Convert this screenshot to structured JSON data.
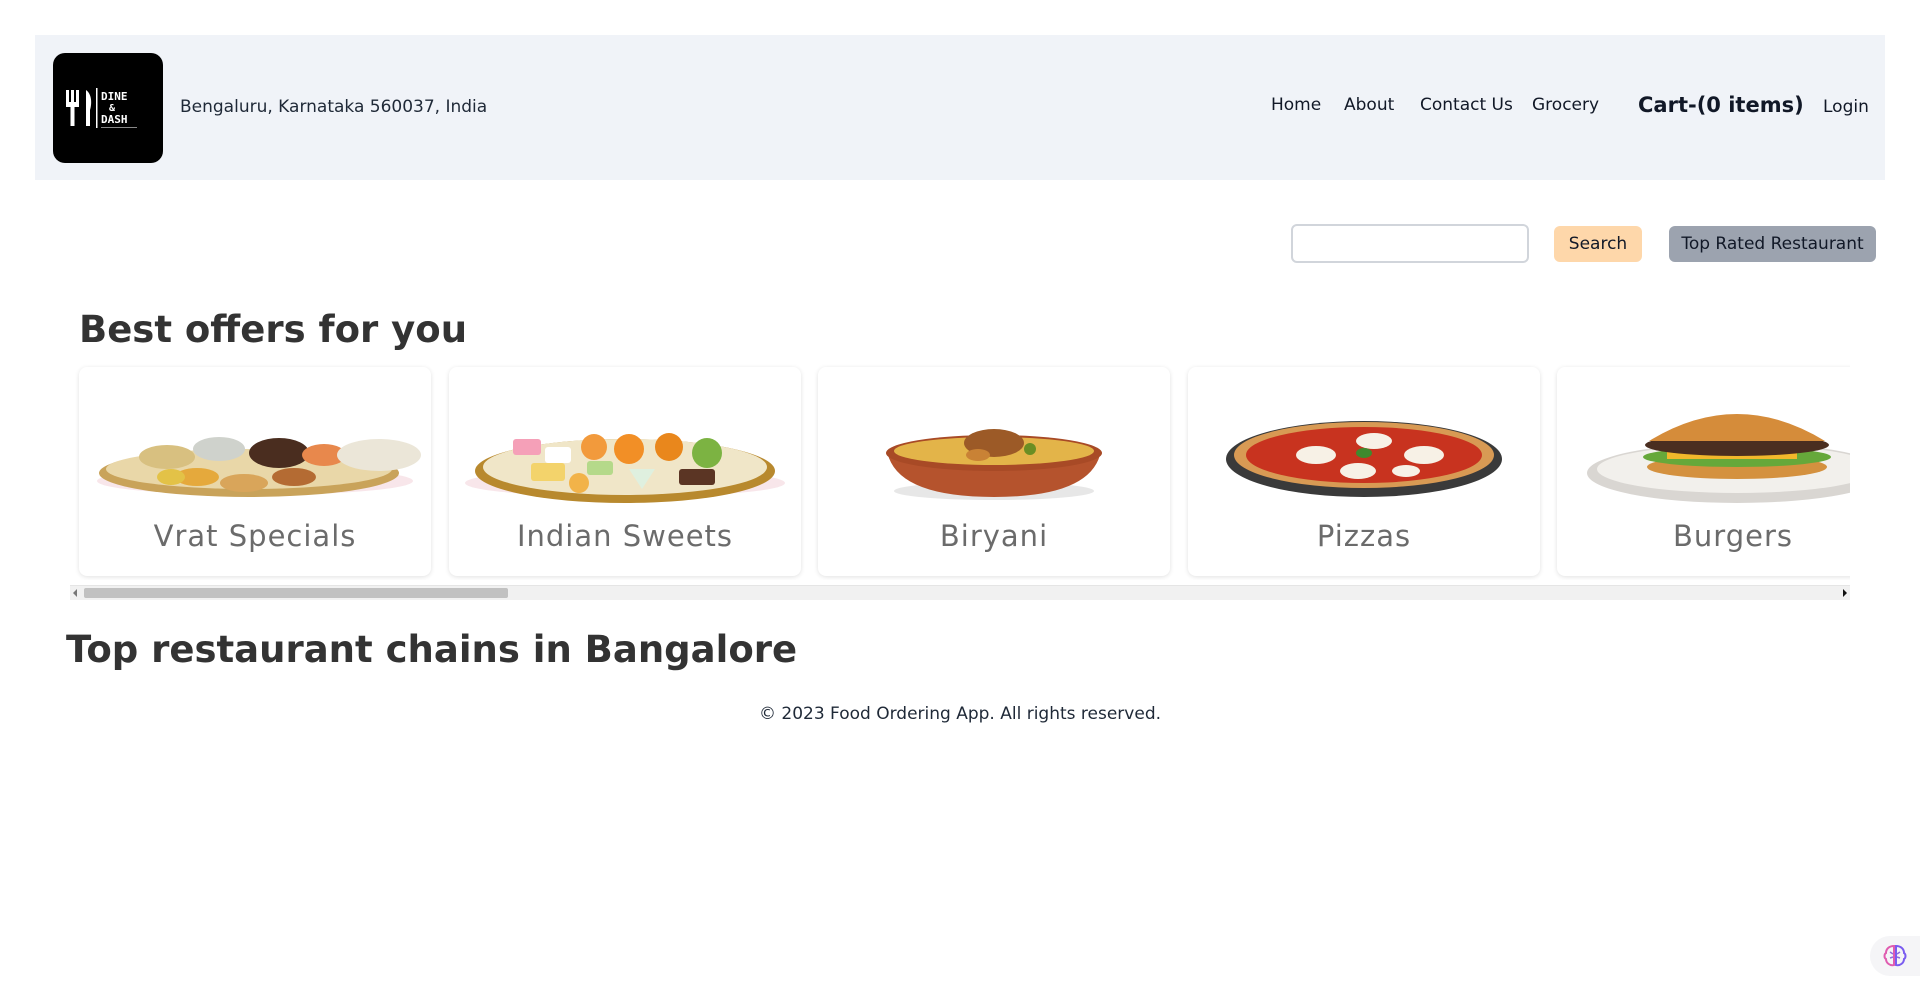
{
  "header": {
    "location": "Bengaluru, Karnataka 560037, India",
    "nav": {
      "home": "Home",
      "about": "About",
      "contact": "Contact Us",
      "grocery": "Grocery",
      "cart": "Cart-(0 items)",
      "login": "Login"
    },
    "logo": {
      "line1": "DINE",
      "line2": "&",
      "line3": "DASH"
    }
  },
  "search": {
    "value": "",
    "button_label": "Search",
    "top_rated_label": "Top Rated Restaurant"
  },
  "offers": {
    "title": "Best offers for you",
    "items": [
      {
        "label": "Vrat Specials"
      },
      {
        "label": "Indian Sweets"
      },
      {
        "label": "Biryani"
      },
      {
        "label": "Pizzas"
      },
      {
        "label": "Burgers"
      }
    ]
  },
  "chains": {
    "title": "Top restaurant chains in Bangalore"
  },
  "footer": {
    "text": "© 2023 Food Ordering App. All rights reserved."
  },
  "colors": {
    "header_bg": "#f0f3f8",
    "search_btn": "#fed7aa",
    "top_rated_btn": "#9ca3af"
  }
}
